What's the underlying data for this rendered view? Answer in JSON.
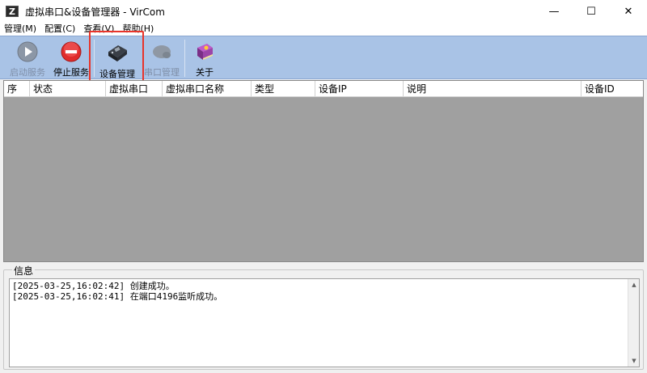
{
  "window": {
    "title": "虚拟串口&设备管理器 - VirCom",
    "app_icon_letter": "Z",
    "minimize_glyph": "—",
    "maximize_glyph": "☐",
    "close_glyph": "✕"
  },
  "menu": {
    "items": [
      {
        "label": "管理(M)"
      },
      {
        "label": "配置(C)"
      },
      {
        "label": "查看(V)"
      },
      {
        "label": "帮助(H)"
      }
    ]
  },
  "toolbar": {
    "start_service": "启动服务",
    "stop_service": "停止服务",
    "device_manage": "设备管理",
    "serial_manage": "串口管理",
    "about": "关于"
  },
  "table": {
    "columns": [
      "序",
      "状态",
      "虚拟串口",
      "虚拟串口名称",
      "类型",
      "设备IP",
      "说明",
      "设备ID"
    ]
  },
  "info": {
    "legend": "信息",
    "lines": [
      "[2025-03-25,16:02:42] 创建成功。",
      "[2025-03-25,16:02:41] 在端口4196监听成功。"
    ]
  },
  "colors": {
    "toolbar_bg": "#a9c3e6",
    "table_bg": "#a0a0a0",
    "highlight": "#e8342a"
  }
}
